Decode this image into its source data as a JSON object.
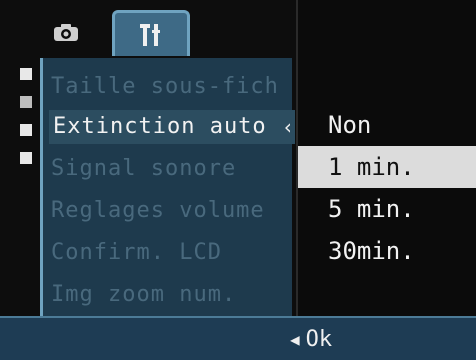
{
  "tabs": {
    "camera": {
      "icon": "camera-icon"
    },
    "setup": {
      "icon": "setup-tools-icon"
    }
  },
  "menu": {
    "items": [
      {
        "label": "Taille sous-fich"
      },
      {
        "label": "Extinction auto"
      },
      {
        "label": "Signal sonore"
      },
      {
        "label": "Reglages volume"
      },
      {
        "label": "Confirm. LCD"
      },
      {
        "label": "Img zoom num."
      }
    ],
    "active_index": 1
  },
  "options": {
    "items": [
      {
        "label": "Non"
      },
      {
        "label": "1 min."
      },
      {
        "label": "5 min."
      },
      {
        "label": "30min."
      }
    ],
    "selected_index": 1
  },
  "footer": {
    "ok_label": "Ok",
    "ok_icon": "left-arrow-icon"
  },
  "colors": {
    "accent": "#3e6a86",
    "menu_bg": "#1e3a4d",
    "selected_bg": "#dcdcdc"
  }
}
